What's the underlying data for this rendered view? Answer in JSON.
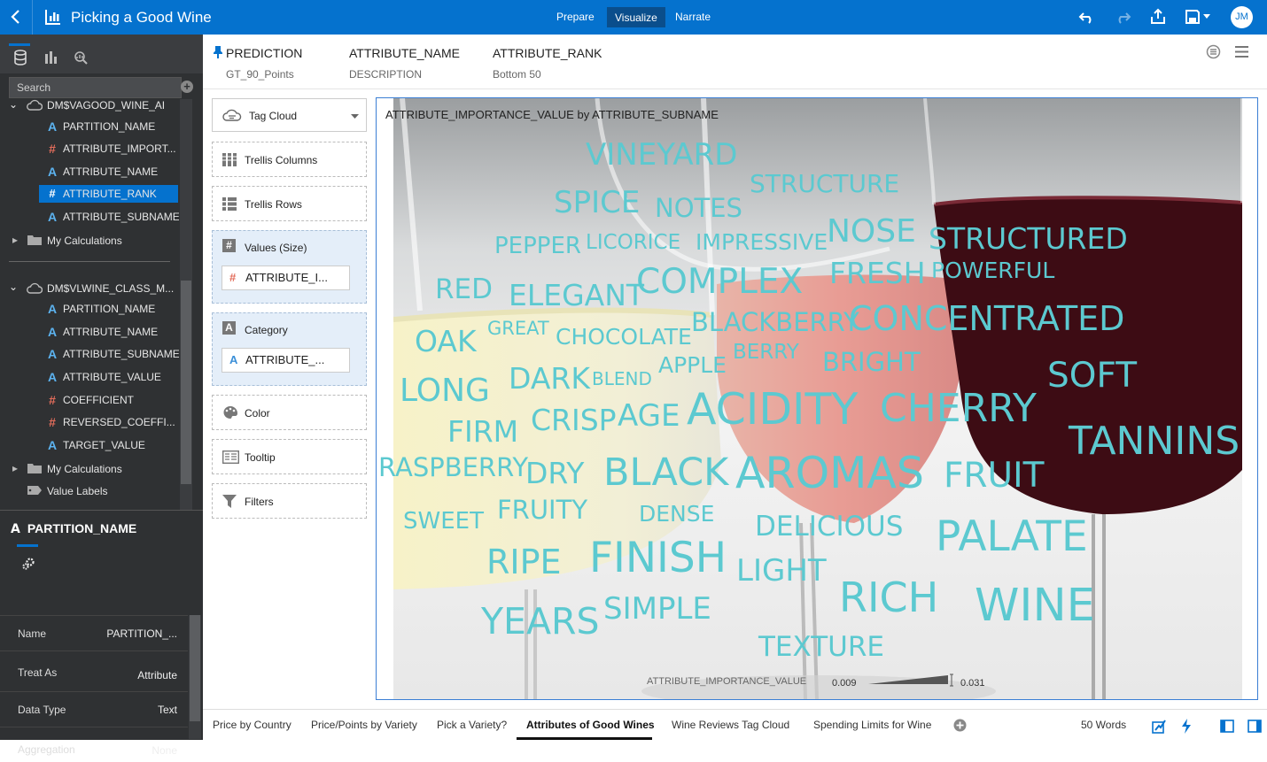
{
  "header": {
    "title": "Picking a Good Wine",
    "modes": [
      "Prepare",
      "Visualize",
      "Narrate"
    ],
    "user_initials": "JM"
  },
  "datapanel": {
    "search_placeholder": "Search",
    "source1": {
      "name": "DM$VAGOOD_WINE_AI",
      "items": [
        {
          "label": "PARTITION_NAME",
          "type": "attribute"
        },
        {
          "label": "ATTRIBUTE_IMPORT...",
          "type": "measure"
        },
        {
          "label": "ATTRIBUTE_NAME",
          "type": "attribute"
        },
        {
          "label": "ATTRIBUTE_RANK",
          "type": "measure"
        },
        {
          "label": "ATTRIBUTE_SUBNAME",
          "type": "attribute"
        }
      ],
      "calculations": "My Calculations"
    },
    "source2": {
      "name": "DM$VLWINE_CLASS_M...",
      "items": [
        {
          "label": "PARTITION_NAME",
          "type": "attribute"
        },
        {
          "label": "ATTRIBUTE_NAME",
          "type": "attribute"
        },
        {
          "label": "ATTRIBUTE_SUBNAME",
          "type": "attribute"
        },
        {
          "label": "ATTRIBUTE_VALUE",
          "type": "attribute"
        },
        {
          "label": "COEFFICIENT",
          "type": "measure"
        },
        {
          "label": "REVERSED_COEFFI...",
          "type": "measure"
        },
        {
          "label": "TARGET_VALUE",
          "type": "attribute"
        }
      ],
      "calculations": "My Calculations",
      "value_labels": "Value Labels"
    }
  },
  "properties": {
    "title": "PARTITION_NAME",
    "rows": [
      {
        "label": "Name",
        "value": "PARTITION_..."
      },
      {
        "label": "Treat As",
        "value": "Attribute"
      },
      {
        "label": "Data Type",
        "value": "Text"
      },
      {
        "label": "Aggregation",
        "value": "None"
      }
    ]
  },
  "grammar": [
    {
      "header": "PREDICTION",
      "sub": "GT_90_Points"
    },
    {
      "header": "ATTRIBUTE_NAME",
      "sub": "DESCRIPTION"
    },
    {
      "header": "ATTRIBUTE_RANK",
      "sub": "Bottom 50"
    }
  ],
  "dropzones": {
    "vis_type": "Tag Cloud",
    "trellis_columns": "Trellis Columns",
    "trellis_rows": "Trellis Rows",
    "values_label": "Values (Size)",
    "values_pill": "ATTRIBUTE_I...",
    "category_label": "Category",
    "category_pill": "ATTRIBUTE_...",
    "color": "Color",
    "tooltip": "Tooltip",
    "filters": "Filters"
  },
  "chart_data": {
    "type": "tag cloud",
    "title": "ATTRIBUTE_IMPORTANCE_VALUE by ATTRIBUTE_SUBNAME",
    "measure": "ATTRIBUTE_IMPORTANCE_VALUE",
    "range": [
      0.009,
      0.031
    ],
    "word_color": "#5cc9d0",
    "words": [
      {
        "text": "VINEYARD",
        "value": 0.019
      },
      {
        "text": "STRUCTURE",
        "value": 0.015
      },
      {
        "text": "SPICE",
        "value": 0.019
      },
      {
        "text": "NOTES",
        "value": 0.016
      },
      {
        "text": "PEPPER",
        "value": 0.014
      },
      {
        "text": "LICORICE",
        "value": 0.012
      },
      {
        "text": "IMPRESSIVE",
        "value": 0.013
      },
      {
        "text": "NOSE",
        "value": 0.02
      },
      {
        "text": "STRUCTURED",
        "value": 0.018
      },
      {
        "text": "RED",
        "value": 0.017
      },
      {
        "text": "ELEGANT",
        "value": 0.018
      },
      {
        "text": "COMPLEX",
        "value": 0.022
      },
      {
        "text": "FRESH",
        "value": 0.018
      },
      {
        "text": "POWERFUL",
        "value": 0.013
      },
      {
        "text": "OAK",
        "value": 0.018
      },
      {
        "text": "GREAT",
        "value": 0.011
      },
      {
        "text": "CHOCOLATE",
        "value": 0.013
      },
      {
        "text": "BLACKBERRY",
        "value": 0.016
      },
      {
        "text": "CONCENTRATED",
        "value": 0.021
      },
      {
        "text": "SOFT",
        "value": 0.022
      },
      {
        "text": "LONG",
        "value": 0.02
      },
      {
        "text": "DARK",
        "value": 0.018
      },
      {
        "text": "BLEND",
        "value": 0.01
      },
      {
        "text": "APPLE",
        "value": 0.013
      },
      {
        "text": "BERRY",
        "value": 0.012
      },
      {
        "text": "BRIGHT",
        "value": 0.016
      },
      {
        "text": "FIRM",
        "value": 0.018
      },
      {
        "text": "CRISP",
        "value": 0.018
      },
      {
        "text": "AGE",
        "value": 0.019
      },
      {
        "text": "ACIDITY",
        "value": 0.028
      },
      {
        "text": "CHERRY",
        "value": 0.025
      },
      {
        "text": "TANNINS",
        "value": 0.025
      },
      {
        "text": "RASPBERRY",
        "value": 0.016
      },
      {
        "text": "DRY",
        "value": 0.018
      },
      {
        "text": "BLACK",
        "value": 0.024
      },
      {
        "text": "AROMAS",
        "value": 0.028
      },
      {
        "text": "FRUIT",
        "value": 0.022
      },
      {
        "text": "SWEET",
        "value": 0.014
      },
      {
        "text": "FRUITY",
        "value": 0.016
      },
      {
        "text": "DENSE",
        "value": 0.013
      },
      {
        "text": "DELICIOUS",
        "value": 0.017
      },
      {
        "text": "PALATE",
        "value": 0.027
      },
      {
        "text": "RIPE",
        "value": 0.021
      },
      {
        "text": "FINISH",
        "value": 0.027
      },
      {
        "text": "LIGHT",
        "value": 0.019
      },
      {
        "text": "RICH",
        "value": 0.026
      },
      {
        "text": "YEARS",
        "value": 0.023
      },
      {
        "text": "SIMPLE",
        "value": 0.019
      },
      {
        "text": "WINE",
        "value": 0.029
      },
      {
        "text": "TEXTURE",
        "value": 0.017
      }
    ]
  },
  "legend": {
    "label": "ATTRIBUTE_IMPORTANCE_VALUE",
    "min": "0.009",
    "max": "0.031"
  },
  "canvas_tabs": [
    "Price by Country",
    "Price/Points by Variety",
    "Pick a Variety?",
    "Attributes of Good Wines",
    "Wine Reviews Tag Cloud",
    "Spending Limits for Wine"
  ],
  "active_canvas_tab": "Attributes of Good Wines",
  "status": {
    "word_count": "50 Words"
  }
}
